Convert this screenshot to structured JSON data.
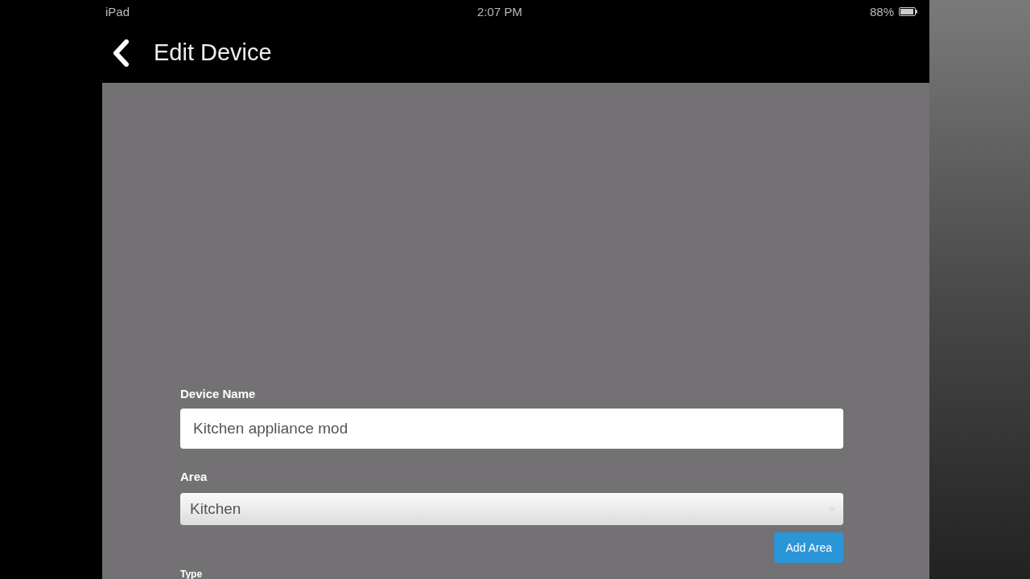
{
  "status_bar": {
    "carrier": "iPad",
    "time": "2:07 PM",
    "battery": "88%"
  },
  "nav_bar": {
    "title": "Edit Device"
  },
  "form": {
    "device_name": {
      "label": "Device Name",
      "value": "Kitchen appliance mod"
    },
    "area": {
      "label": "Area",
      "value": "Kitchen"
    },
    "add_area_button": "Add Area",
    "type": {
      "label": "Type"
    }
  }
}
